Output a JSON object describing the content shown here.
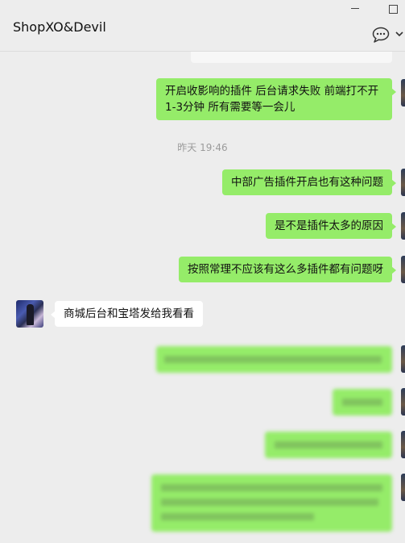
{
  "window": {
    "title": "ShopXO&Devil"
  },
  "icons": {
    "more": "chat-bubble-more-icon",
    "expand": "chevron-down-icon",
    "minimize": "minimize-icon",
    "maximize": "maximize-icon"
  },
  "colors": {
    "background": "#ededed",
    "bubble_self": "#95ec69",
    "bubble_other": "#ffffff",
    "timestamp_text": "#9b9b9b"
  },
  "messages": {
    "m1": "开启收影响的插件  后台请求失败  前端打不开1-3分钟  所有需要等一会儿",
    "timestamp": "昨天 19:46",
    "m2": "中部广告插件开启也有这种问题",
    "m3": "是不是插件太多的原因",
    "m4": "按照常理不应该有这么多插件都有问题呀",
    "m5": "商城后台和宝塔发给我看看"
  }
}
